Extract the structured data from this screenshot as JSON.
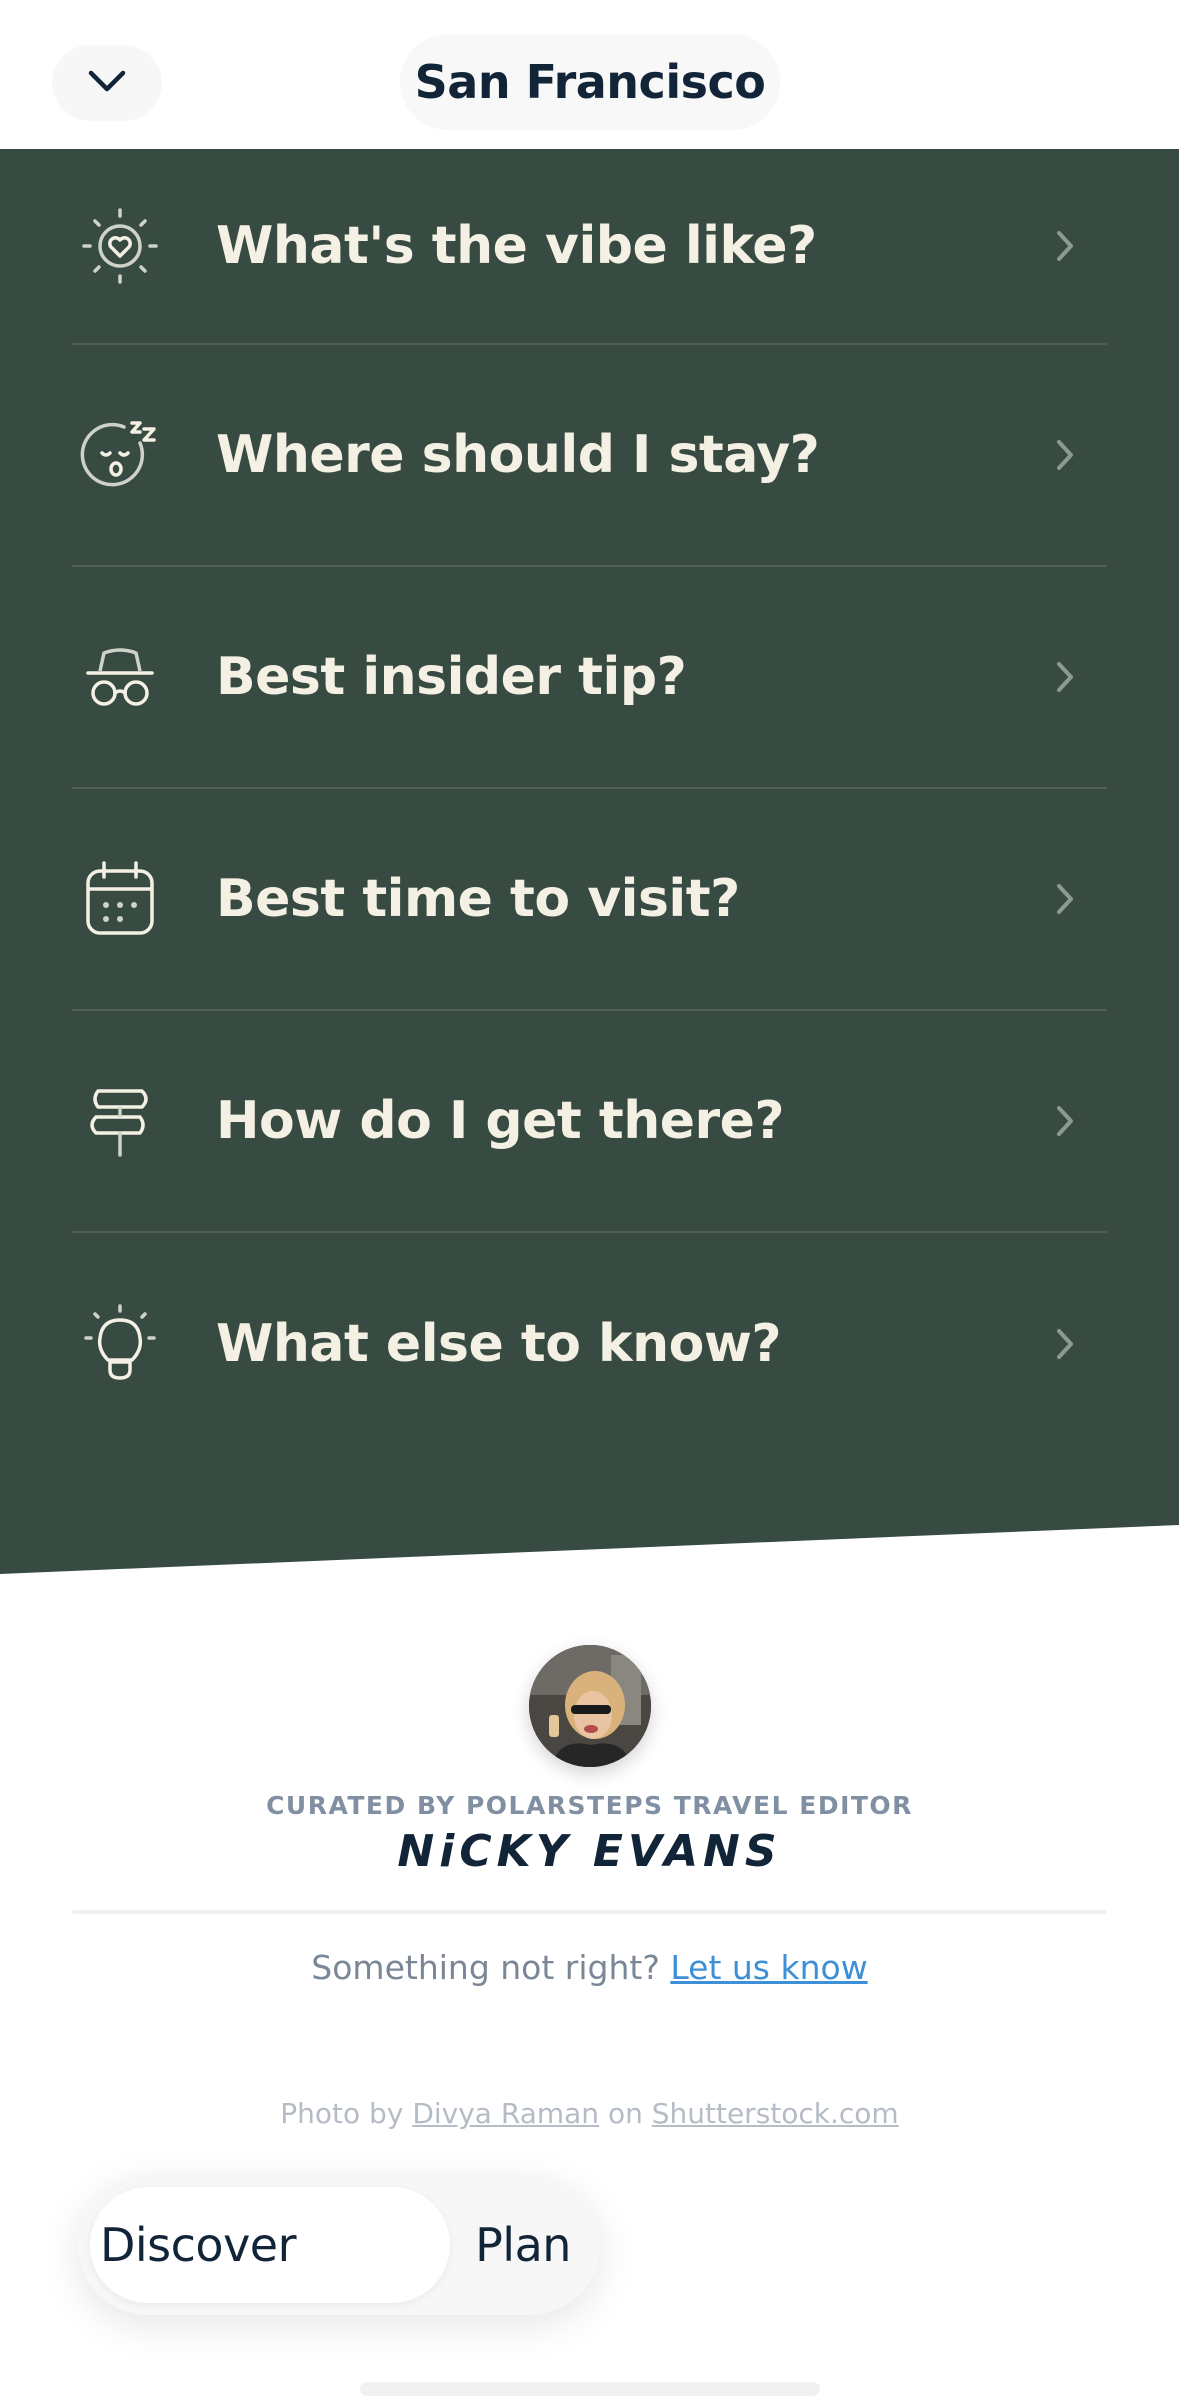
{
  "header": {
    "title": "San Francisco",
    "back_icon": "chevron-down-icon"
  },
  "topics": [
    {
      "label": "What's the vibe like?",
      "icon": "heart-sun-icon"
    },
    {
      "label": "Where should I stay?",
      "icon": "sleeping-face-icon"
    },
    {
      "label": "Best insider tip?",
      "icon": "incognito-icon"
    },
    {
      "label": "Best time to visit?",
      "icon": "calendar-icon"
    },
    {
      "label": "How do I get there?",
      "icon": "signpost-icon"
    },
    {
      "label": "What else to know?",
      "icon": "lightbulb-icon"
    }
  ],
  "curator": {
    "heading": "CURATED BY POLARSTEPS TRAVEL EDITOR",
    "name": "NiCKY EVANS"
  },
  "feedback": {
    "text": "Something not right?",
    "link": "Let us know"
  },
  "credit": {
    "prefix": "Photo by",
    "photographer": "Divya Raman",
    "middle": "on",
    "source": "Shutterstock.com"
  },
  "nav": {
    "discover": "Discover",
    "plan": "Plan"
  },
  "colors": {
    "section_bg": "#374b42",
    "topic_text": "#f5f0e4",
    "title_text": "#122538",
    "link": "#3d8fd6"
  }
}
